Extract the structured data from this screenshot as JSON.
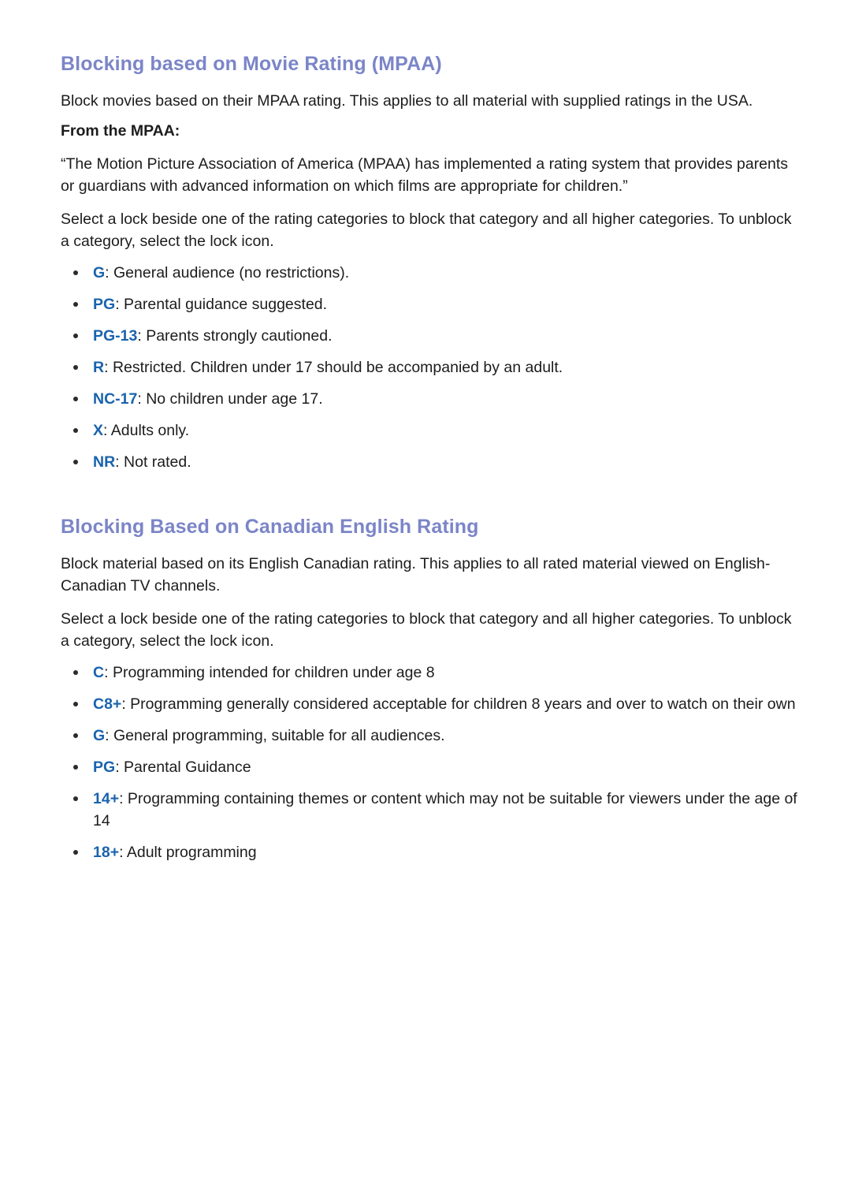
{
  "document": {
    "title": "Blocking based on Movie Rating (MPAA)",
    "heading_color": "#7b85c8",
    "code_color": "#1a63ad",
    "body_color": "#1c1c1c"
  },
  "sections": [
    {
      "heading": "Blocking based on Movie Rating (MPAA)",
      "intro": "Block movies based on their MPAA rating. This applies to all material with supplied ratings in the USA.",
      "subheading": "From the MPAA:",
      "quote": "“The Motion Picture Association of America (MPAA) has implemented a rating system that provides parents or guardians with advanced information on which films are appropriate for children.”",
      "instruction": "Select a lock beside one of the rating categories to block that category and all higher categories. To unblock a category, select the lock icon.",
      "ratings": [
        {
          "code": "G",
          "separator": ":",
          "description": "General audience (no restrictions)."
        },
        {
          "code": "PG",
          "separator": ":",
          "description": "Parental guidance suggested."
        },
        {
          "code": "PG-13",
          "separator": ":",
          "description": "Parents strongly cautioned."
        },
        {
          "code": "R",
          "separator": ":",
          "description": "Restricted. Children under 17 should be accompanied by an adult."
        },
        {
          "code": "NC-17",
          "separator": ":",
          "description": "No children under age 17."
        },
        {
          "code": "X",
          "separator": ":",
          "description": "Adults only."
        },
        {
          "code": "NR",
          "separator": ":",
          "description": "Not rated."
        }
      ]
    },
    {
      "heading": "Blocking Based on Canadian English Rating",
      "intro": "Block material based on its English Canadian rating. This applies to all rated material viewed on English-Canadian TV channels.",
      "instruction": "Select a lock beside one of the rating categories to block that category and all higher categories. To unblock a category, select the lock icon.",
      "ratings": [
        {
          "code": "C",
          "separator": ":",
          "description": "Programming intended for children under age 8"
        },
        {
          "code": "C8+",
          "separator": ":",
          "description": "Programming generally considered acceptable for children 8 years and over to watch on their own"
        },
        {
          "code": "G",
          "separator": ":",
          "description": "General programming, suitable for all audiences."
        },
        {
          "code": "PG",
          "separator": ":",
          "description": "Parental Guidance"
        },
        {
          "code": "14+",
          "separator": ":",
          "description": "Programming containing themes or content which may not be suitable for viewers under the age of 14"
        },
        {
          "code": "18+",
          "separator": ":",
          "description": "Adult programming"
        }
      ]
    }
  ]
}
